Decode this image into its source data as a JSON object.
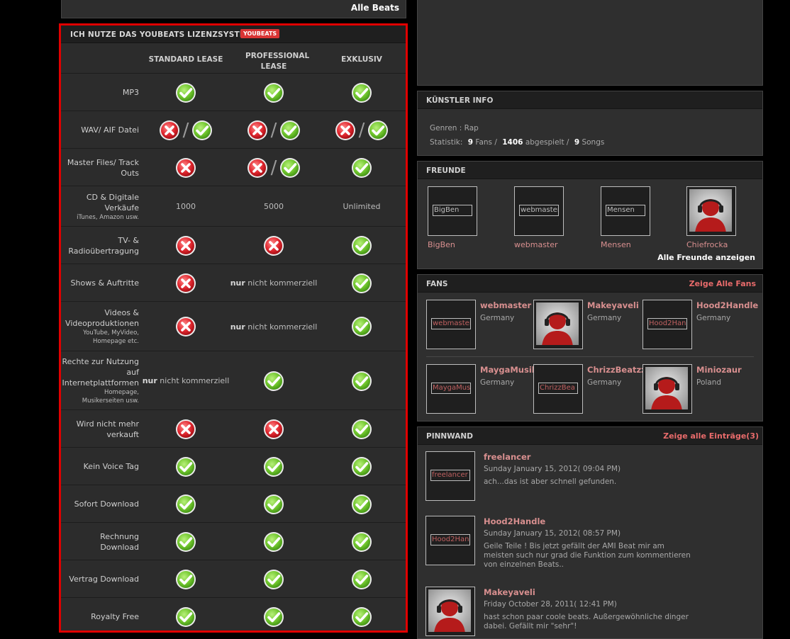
{
  "top": {
    "all_beats": "Alle Beats"
  },
  "license": {
    "title": "ICH NUTZE DAS YOUBEATS LIZENZSYSTEM",
    "badge": "YOUBEATS",
    "columns": [
      "STANDARD LEASE",
      "PROFESSIONAL LEASE",
      "EXKLUSIV"
    ],
    "rows": [
      {
        "label": "MP3",
        "sub": "",
        "cells": [
          "check",
          "check",
          "check"
        ]
      },
      {
        "label": "WAV/ AIF Datei",
        "sub": "",
        "cells": [
          "cross-check",
          "cross-check",
          "cross-check"
        ]
      },
      {
        "label": "Master Files/ Track Outs",
        "sub": "",
        "cells": [
          "cross",
          "cross-check",
          "check"
        ]
      },
      {
        "label": "CD & Digitale Verkäufe",
        "sub": "iTunes, Amazon usw.",
        "cells": [
          "1000",
          "5000",
          "Unlimited"
        ]
      },
      {
        "label": "TV- & Radioübertragung",
        "sub": "",
        "cells": [
          "cross",
          "cross",
          "check"
        ]
      },
      {
        "label": "Shows & Auftritte",
        "sub": "",
        "cells": [
          "cross",
          "nur|nicht kommerziell",
          "check"
        ]
      },
      {
        "label": "Videos & Videoproduktionen",
        "sub": "YouTube, MyVideo, Homepage etc.",
        "cells": [
          "cross",
          "nur|nicht kommerziell",
          "check"
        ]
      },
      {
        "label": "Rechte zur Nutzung auf Internetplattformen",
        "sub": "Homepage, Musikerseiten usw.",
        "cells": [
          "nur|nicht kommerziell",
          "check",
          "check"
        ]
      },
      {
        "label": "Wird nicht mehr verkauft",
        "sub": "",
        "cells": [
          "cross",
          "cross",
          "check"
        ]
      },
      {
        "label": "Kein Voice Tag",
        "sub": "",
        "cells": [
          "check",
          "check",
          "check"
        ]
      },
      {
        "label": "Sofort Download",
        "sub": "",
        "cells": [
          "check",
          "check",
          "check"
        ]
      },
      {
        "label": "Rechnung Download",
        "sub": "",
        "cells": [
          "check",
          "check",
          "check"
        ]
      },
      {
        "label": "Vertrag Download",
        "sub": "",
        "cells": [
          "check",
          "check",
          "check"
        ]
      },
      {
        "label": "Royalty Free",
        "sub": "",
        "cells": [
          "check",
          "check",
          "check"
        ]
      }
    ]
  },
  "artist": {
    "title": "KÜNSTLER INFO",
    "genre_label": "Genren :",
    "genre": "Rap",
    "stats_label": "Statistik:",
    "fans": "9",
    "fans_word": "Fans /",
    "plays": "1406",
    "plays_word": "abgespielt /",
    "songs": "9",
    "songs_word": "Songs"
  },
  "friends": {
    "title": "FREUNDE",
    "items": [
      {
        "name": "BigBen",
        "alt": "BigBen",
        "avatar": false
      },
      {
        "name": "webmaster",
        "alt": "webmaster",
        "avatar": false
      },
      {
        "name": "Mensen",
        "alt": "Mensen",
        "avatar": false
      },
      {
        "name": "Chiefrocka",
        "alt": "",
        "avatar": true
      }
    ],
    "show_all": "Alle Freunde anzeigen"
  },
  "fans": {
    "title": "FANS",
    "show_all": "Zeige Alle Fans",
    "items": [
      {
        "name": "webmaster",
        "country": "Germany",
        "alt": "webmaster",
        "avatar": false
      },
      {
        "name": "Makeyaveli",
        "country": "Germany",
        "alt": "",
        "avatar": true
      },
      {
        "name": "Hood2Handle",
        "country": "Germany",
        "alt": "Hood2Han",
        "avatar": false
      },
      {
        "name": "MaygaMusik",
        "country": "Germany",
        "alt": "MaygaMus",
        "avatar": false
      },
      {
        "name": "ChrizzBeatzz",
        "country": "Germany",
        "alt": "ChrizzBea",
        "avatar": false
      },
      {
        "name": "Miniozaur",
        "country": "Poland",
        "alt": "",
        "avatar": true
      }
    ]
  },
  "wall": {
    "title": "PINNWAND",
    "show_all": "Zeige alle Einträge(3)",
    "items": [
      {
        "name": "freelancer",
        "alt": "freelancer",
        "date": "Sunday January 15, 2012( 09:04 PM)",
        "text": "ach...das ist aber schnell gefunden.",
        "avatar": false
      },
      {
        "name": "Hood2Handle",
        "alt": "Hood2Han",
        "date": "Sunday January 15, 2012( 08:57 PM)",
        "text": "Geile Teile ! Bis jetzt gefällt der AMI Beat mir am meisten such nur grad die Funktion zum kommentieren von einzelnen Beats..",
        "avatar": false
      },
      {
        "name": "Makeyaveli",
        "alt": "",
        "date": "Friday October 28, 2011( 12:41 PM)",
        "text": "hast schon paar coole beats. Außergewöhnliche dinger dabei. Gefällt mir \"sehr\"!",
        "avatar": true
      }
    ]
  }
}
